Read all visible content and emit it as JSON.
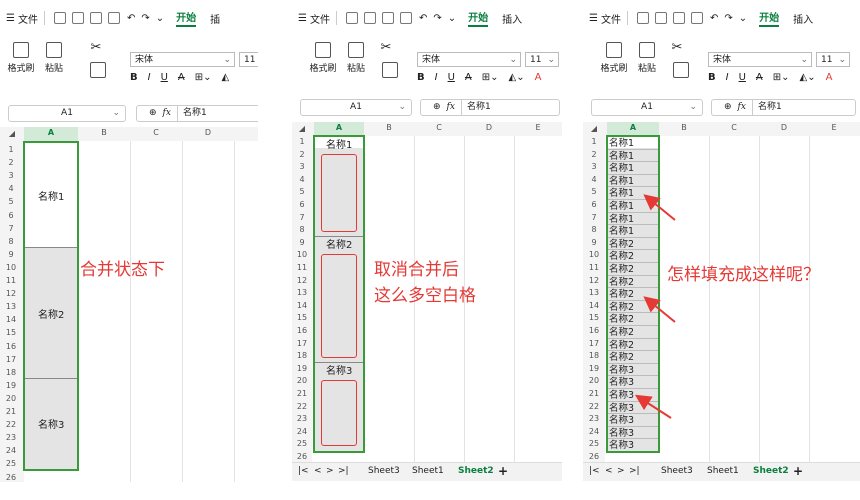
{
  "menu": {
    "file": "文件",
    "start": "开始",
    "insert": "插入"
  },
  "ribbon": {
    "format_painter": "格式刷",
    "paste": "粘贴",
    "font_name": "宋体",
    "font_size": "11",
    "bold": "B",
    "italic": "I",
    "underline": "U",
    "strike": "A"
  },
  "formula_bar": {
    "cell_ref": "A1",
    "fx": "fx",
    "content": "名称1"
  },
  "columns": [
    "A",
    "B",
    "C",
    "D",
    "E"
  ],
  "rows": 26,
  "groups": [
    {
      "label": "名称1"
    },
    {
      "label": "名称2"
    },
    {
      "label": "名称3"
    }
  ],
  "annotations": {
    "merged": "合并状态下",
    "unmerged_line1": "取消合并后",
    "unmerged_line2": "这么多空白格",
    "question": "怎样填充成这样呢？"
  },
  "sheet_tabs": [
    "Sheet3",
    "Sheet1",
    "Sheet2"
  ],
  "nav": [
    "|<",
    "<",
    ">",
    ">|"
  ],
  "add_sheet": "+",
  "colors": {
    "accent": "#0a7f3f",
    "selection_border": "#3a9a3a",
    "annotation": "#e53935",
    "merged_fill": "#e4e4e4"
  }
}
